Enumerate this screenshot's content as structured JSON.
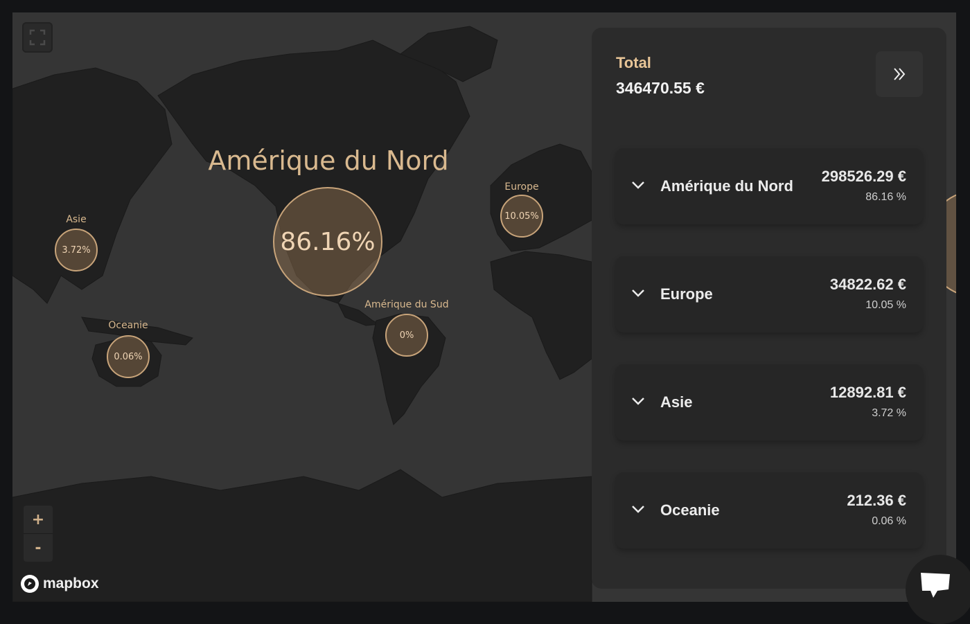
{
  "map": {
    "attribution": "mapbox",
    "zoom_in_label": "+",
    "zoom_out_label": "-",
    "fullscreen_icon": "expand-icon",
    "regions": [
      {
        "name": "Amérique du Nord",
        "percent": "86.16%"
      },
      {
        "name": "Europe",
        "percent": "10.05%"
      },
      {
        "name": "Asie",
        "percent": "3.72%"
      },
      {
        "name": "Amérique du Sud",
        "percent": "0%"
      },
      {
        "name": "Oceanie",
        "percent": "0.06%"
      }
    ]
  },
  "panel": {
    "total_label": "Total",
    "total_value": "346470.55 €",
    "collapse_icon": "double-chevron-right-icon",
    "items": [
      {
        "name": "Amérique du Nord",
        "amount": "298526.29 €",
        "percent": "86.16 %"
      },
      {
        "name": "Europe",
        "amount": "34822.62 €",
        "percent": "10.05 %"
      },
      {
        "name": "Asie",
        "amount": "12892.81 €",
        "percent": "3.72 %"
      },
      {
        "name": "Oceanie",
        "amount": "212.36 €",
        "percent": "0.06 %"
      }
    ]
  },
  "chat_icon": "chat-icon",
  "colors": {
    "accent": "#e8c597",
    "bubble_border": "#c8a47a",
    "land": "#202020",
    "ocean": "#353535"
  }
}
